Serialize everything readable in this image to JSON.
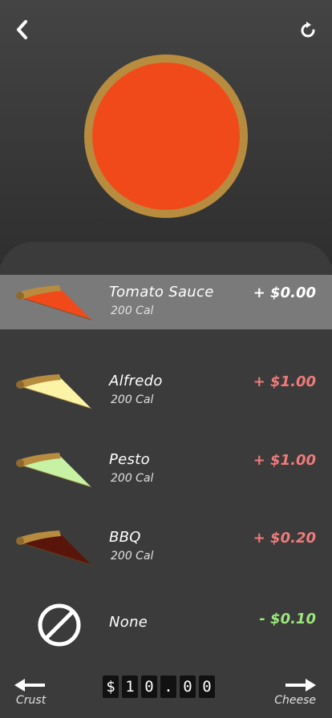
{
  "colors": {
    "selected_sauce": "#f14a1a",
    "crust": "#b88c3f",
    "price_positive": "#f07a7a",
    "price_negative": "#9be87b"
  },
  "header": {
    "back_icon": "chevron-left-icon",
    "reset_icon": "refresh-icon"
  },
  "sauces": [
    {
      "name": "Tomato Sauce",
      "cal": "200 Cal",
      "price": "+ $0.00",
      "color": "#f14a1a",
      "selected": true
    },
    {
      "name": "Alfredo",
      "cal": "200 Cal",
      "price": "+ $1.00",
      "color": "#fbf4a6",
      "selected": false
    },
    {
      "name": "Pesto",
      "cal": "200 Cal",
      "price": "+ $1.00",
      "color": "#c8f2a3",
      "selected": false
    },
    {
      "name": "BBQ",
      "cal": "200 Cal",
      "price": "+ $0.20",
      "color": "#5a150a",
      "selected": false
    },
    {
      "name": "None",
      "price": "- $0.10",
      "selected": false
    }
  ],
  "footer": {
    "prev_label": "Crust",
    "next_label": "Cheese",
    "total_digits": [
      "$",
      "1",
      "0",
      ".",
      "0",
      "0"
    ]
  }
}
